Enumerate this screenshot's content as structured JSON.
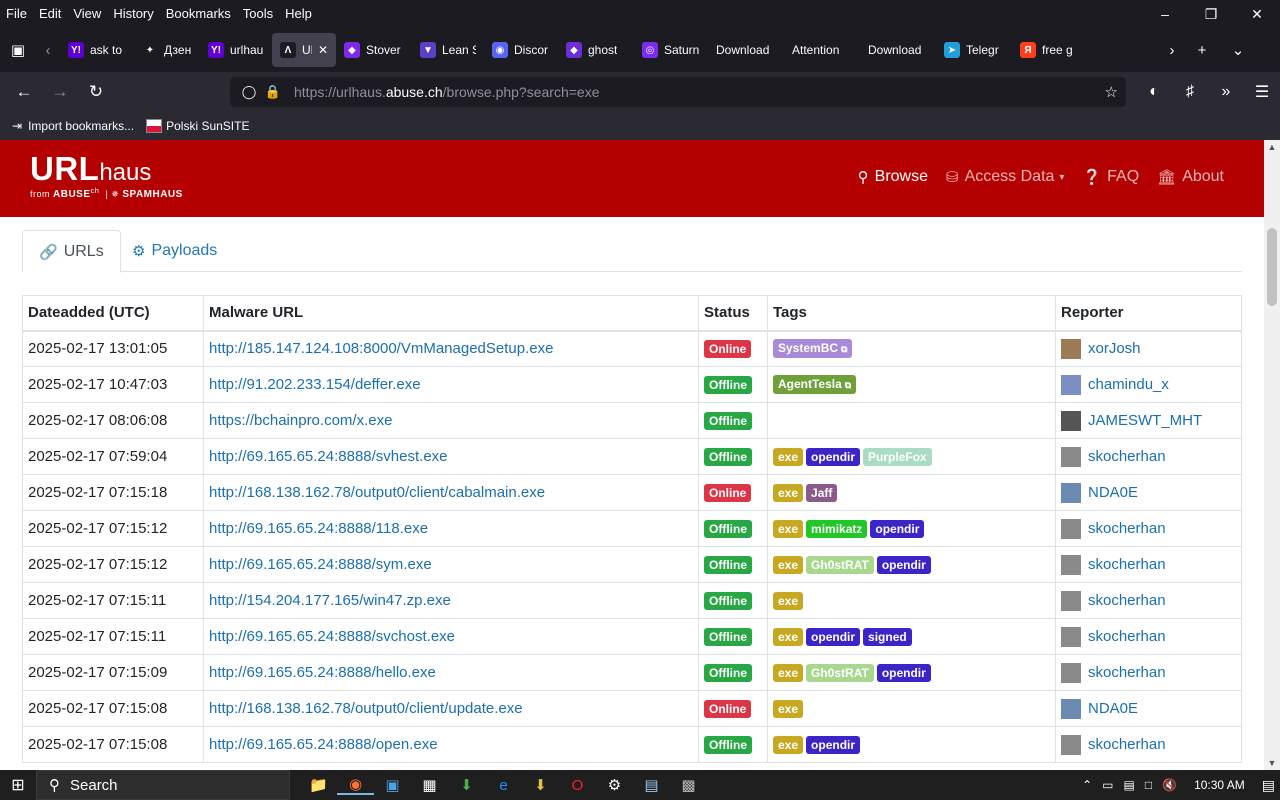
{
  "menubar": {
    "items": [
      "File",
      "Edit",
      "View",
      "History",
      "Bookmarks",
      "Tools",
      "Help"
    ]
  },
  "tabs": [
    {
      "label": "ask to",
      "favicon": "Y!",
      "color": "#6001d2"
    },
    {
      "label": "Дзен",
      "favicon": "✦",
      "color": "#1c1b22"
    },
    {
      "label": "urlhau",
      "favicon": "Y!",
      "color": "#6001d2"
    },
    {
      "label": "URL",
      "favicon": "Λ",
      "color": "#1c1b22",
      "active": true
    },
    {
      "label": "Stover",
      "favicon": "◆",
      "color": "#7d2ae8"
    },
    {
      "label": "Lean S",
      "favicon": "▼",
      "color": "#5b3fc4"
    },
    {
      "label": "Discor",
      "favicon": "◉",
      "color": "#5865f2"
    },
    {
      "label": "ghost",
      "favicon": "◆",
      "color": "#6b2fd6"
    },
    {
      "label": "Saturn",
      "favicon": "◎",
      "color": "#7b2cf0"
    },
    {
      "label": "Download",
      "favicon": "",
      "color": ""
    },
    {
      "label": "Attention",
      "favicon": "",
      "color": ""
    },
    {
      "label": "Download",
      "favicon": "",
      "color": ""
    },
    {
      "label": "Telegr",
      "favicon": "➤",
      "color": "#229ed9"
    },
    {
      "label": "free g",
      "favicon": "Я",
      "color": "#fc3f1d"
    }
  ],
  "nav": {
    "url_host": "https://urlhaus.",
    "url_domain": "abuse.ch",
    "url_path": "/browse.php?search=exe"
  },
  "bookmarks": [
    {
      "label": "Import bookmarks..."
    },
    {
      "label": "Polski SunSITE"
    }
  ],
  "site": {
    "logo_main": "URL",
    "logo_sub": "haus",
    "logo_from": "from",
    "logo_abuse": "ABUSE",
    "logo_abuse_sup": "ch",
    "logo_spamhaus": "SPAMHAUS",
    "nav": {
      "browse": "Browse",
      "access": "Access Data",
      "faq": "FAQ",
      "about": "About"
    },
    "tabs": {
      "urls": "URLs",
      "payloads": "Payloads"
    }
  },
  "table": {
    "headers": [
      "Dateadded (UTC)",
      "Malware URL",
      "Status",
      "Tags",
      "Reporter"
    ],
    "rows": [
      {
        "date": "2025-02-17 13:01:05",
        "url": "http://185.147.124.108:8000/VmManagedSetup.exe",
        "status": "Online",
        "tags": [
          {
            "t": "SystemBC",
            "ext": true
          }
        ],
        "reporter": "xorJosh",
        "av": "#9c7a55"
      },
      {
        "date": "2025-02-17 10:47:03",
        "url": "http://91.202.233.154/deffer.exe",
        "status": "Offline",
        "tags": [
          {
            "t": "AgentTesla",
            "ext": true
          }
        ],
        "reporter": "chamindu_x",
        "av": "#7b8fc4"
      },
      {
        "date": "2025-02-17 08:06:08",
        "url": "https://bchainpro.com/x.exe",
        "status": "Offline",
        "tags": [],
        "reporter": "JAMESWT_MHT",
        "av": "#555555"
      },
      {
        "date": "2025-02-17 07:59:04",
        "url": "http://69.165.65.24:8888/svhest.exe",
        "status": "Offline",
        "tags": [
          {
            "t": "exe"
          },
          {
            "t": "opendir"
          },
          {
            "t": "PurpleFox"
          }
        ],
        "reporter": "skocherhan",
        "av": "#8a8a8a"
      },
      {
        "date": "2025-02-17 07:15:18",
        "url": "http://168.138.162.78/output0/client/cabalmain.exe",
        "status": "Online",
        "tags": [
          {
            "t": "exe"
          },
          {
            "t": "Jaff"
          }
        ],
        "reporter": "NDA0E",
        "av": "#6a8ab0"
      },
      {
        "date": "2025-02-17 07:15:12",
        "url": "http://69.165.65.24:8888/118.exe",
        "status": "Offline",
        "tags": [
          {
            "t": "exe"
          },
          {
            "t": "mimikatz"
          },
          {
            "t": "opendir"
          }
        ],
        "reporter": "skocherhan",
        "av": "#8a8a8a"
      },
      {
        "date": "2025-02-17 07:15:12",
        "url": "http://69.165.65.24:8888/sym.exe",
        "status": "Offline",
        "tags": [
          {
            "t": "exe"
          },
          {
            "t": "Gh0stRAT"
          },
          {
            "t": "opendir"
          }
        ],
        "reporter": "skocherhan",
        "av": "#8a8a8a"
      },
      {
        "date": "2025-02-17 07:15:11",
        "url": "http://154.204.177.165/win47.zp.exe",
        "status": "Offline",
        "tags": [
          {
            "t": "exe"
          }
        ],
        "reporter": "skocherhan",
        "av": "#8a8a8a"
      },
      {
        "date": "2025-02-17 07:15:11",
        "url": "http://69.165.65.24:8888/svchost.exe",
        "status": "Offline",
        "tags": [
          {
            "t": "exe"
          },
          {
            "t": "opendir"
          },
          {
            "t": "signed"
          }
        ],
        "reporter": "skocherhan",
        "av": "#8a8a8a"
      },
      {
        "date": "2025-02-17 07:15:09",
        "url": "http://69.165.65.24:8888/hello.exe",
        "status": "Offline",
        "tags": [
          {
            "t": "exe"
          },
          {
            "t": "Gh0stRAT"
          },
          {
            "t": "opendir"
          }
        ],
        "reporter": "skocherhan",
        "av": "#8a8a8a"
      },
      {
        "date": "2025-02-17 07:15:08",
        "url": "http://168.138.162.78/output0/client/update.exe",
        "status": "Online",
        "tags": [
          {
            "t": "exe"
          }
        ],
        "reporter": "NDA0E",
        "av": "#6a8ab0"
      },
      {
        "date": "2025-02-17 07:15:08",
        "url": "http://69.165.65.24:8888/open.exe",
        "status": "Offline",
        "tags": [
          {
            "t": "exe"
          },
          {
            "t": "opendir"
          }
        ],
        "reporter": "skocherhan",
        "av": "#8a8a8a"
      }
    ]
  },
  "taskbar": {
    "search_label": "Search",
    "clock": "10:30 AM"
  }
}
